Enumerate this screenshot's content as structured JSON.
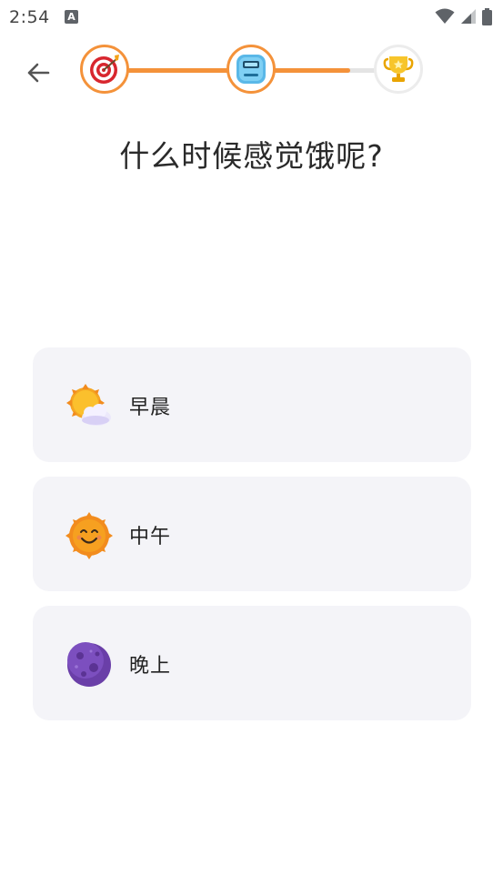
{
  "status_bar": {
    "time": "2:54",
    "notification_letter": "A"
  },
  "header": {
    "back_label": "back",
    "steps": [
      {
        "icon": "target-icon",
        "state": "active"
      },
      {
        "icon": "scale-icon",
        "state": "active"
      },
      {
        "icon": "trophy-icon",
        "state": "inactive"
      }
    ],
    "progress": 0.84
  },
  "question": {
    "title": "什么时候感觉饿呢?"
  },
  "options": [
    {
      "label": "早晨",
      "icon": "sun-behind-cloud-icon"
    },
    {
      "label": "中午",
      "icon": "smiling-sun-icon"
    },
    {
      "label": "晚上",
      "icon": "purple-moon-icon"
    }
  ],
  "colors": {
    "accent": "#f4923a",
    "option_bg": "#f4f4f8",
    "track_bg": "#e4e4e4"
  }
}
